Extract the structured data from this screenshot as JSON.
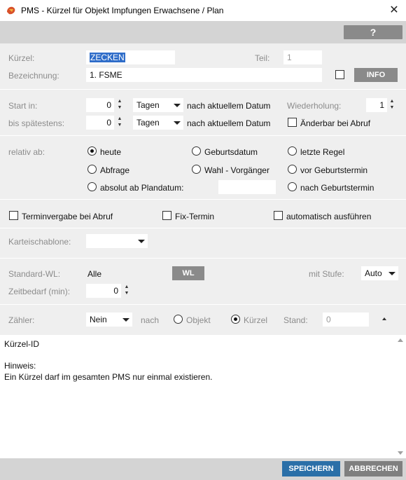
{
  "window": {
    "title": "PMS - Kürzel für Objekt Impfungen Erwachsene / Plan",
    "close": "✕",
    "help": "?"
  },
  "header": {
    "kuerzel_label": "Kürzel:",
    "kuerzel_value": "ZECKEN",
    "teil_label": "Teil:",
    "teil_value": "1",
    "bezeichnung_label": "Bezeichnung:",
    "bezeichnung_value": "1. FSME",
    "info_label": "INFO"
  },
  "schedule": {
    "start_label": "Start in:",
    "start_value": "0",
    "start_unit": "Tagen",
    "start_suffix": "nach aktuellem Datum",
    "latest_label": "bis spätestens:",
    "latest_value": "0",
    "latest_unit": "Tagen",
    "latest_suffix": "nach aktuellem Datum",
    "repeat_label": "Wiederholung:",
    "repeat_value": "1",
    "changeable_label": "Änderbar bei Abruf"
  },
  "relative": {
    "label": "relativ ab:",
    "options": {
      "heute": "heute",
      "geburtsdatum": "Geburtsdatum",
      "letzte_regel": "letzte Regel",
      "abfrage": "Abfrage",
      "wahl_vorgaenger": "Wahl - Vorgänger",
      "vor_geburtstermin": "vor Geburtstermin",
      "absolut": "absolut ab Plandatum:",
      "nach_geburtstermin": "nach Geburtstermin"
    },
    "selected": "heute"
  },
  "options": {
    "terminvergabe": "Terminvergabe bei Abruf",
    "fix_termin": "Fix-Termin",
    "automatisch": "automatisch ausführen"
  },
  "karteischablone": {
    "label": "Karteischablone:"
  },
  "wl": {
    "standard_label": "Standard-WL:",
    "standard_value": "Alle",
    "wl_button": "WL",
    "stufe_label": "mit Stufe:",
    "stufe_value": "Auto",
    "zeitbedarf_label": "Zeitbedarf (min):",
    "zeitbedarf_value": "0"
  },
  "counter": {
    "label": "Zähler:",
    "value": "Nein",
    "nach_label": "nach",
    "objekt_label": "Objekt",
    "kuerzel_label": "Kürzel",
    "stand_label": "Stand:",
    "stand_value": "0",
    "selected": "kuerzel"
  },
  "notes": {
    "line1": "Kürzel-ID",
    "line2": "Hinweis:",
    "line3": "Ein Kürzel darf im gesamten PMS nur einmal existieren."
  },
  "footer": {
    "save": "SPEICHERN",
    "cancel": "ABBRECHEN"
  }
}
